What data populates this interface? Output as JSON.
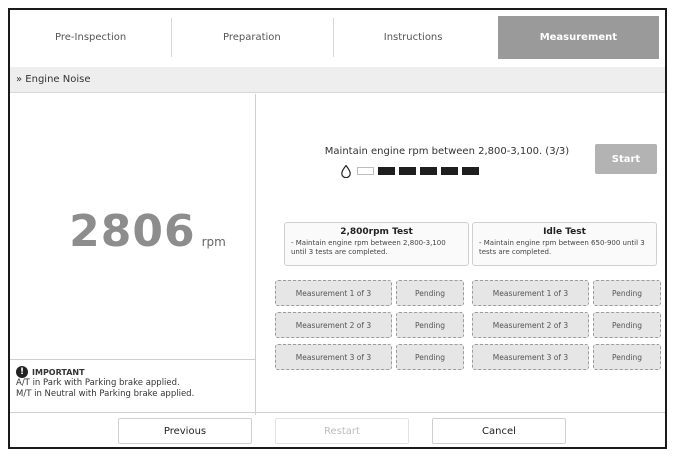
{
  "tabs": [
    {
      "label": "Pre-Inspection",
      "active": false
    },
    {
      "label": "Preparation",
      "active": false
    },
    {
      "label": "Instructions",
      "active": false
    },
    {
      "label": "Measurement",
      "active": true
    }
  ],
  "section": {
    "title": "» Engine Noise"
  },
  "rpm": {
    "value": "2806",
    "unit": "rpm"
  },
  "notice": {
    "heading": "IMPORTANT",
    "line1": "A/T in Park with Parking brake applied.",
    "line2": "M/T in Neutral with Parking brake applied."
  },
  "instruction": "Maintain engine rpm between 2,800-3,100. (3/3)",
  "progress": {
    "total": 6,
    "filled": 5
  },
  "start_button": "Start",
  "tests": [
    {
      "title": "2,800rpm Test",
      "desc": "- Maintain engine rpm between 2,800-3,100 until 3 tests are completed.",
      "rows": [
        {
          "measure": "Measurement 1 of 3",
          "status": "Pending"
        },
        {
          "measure": "Measurement 2 of 3",
          "status": "Pending"
        },
        {
          "measure": "Measurement 3 of 3",
          "status": "Pending"
        }
      ]
    },
    {
      "title": "Idle Test",
      "desc": "- Maintain engine rpm between 650-900 until 3 tests are completed.",
      "rows": [
        {
          "measure": "Measurement 1 of 3",
          "status": "Pending"
        },
        {
          "measure": "Measurement 2 of 3",
          "status": "Pending"
        },
        {
          "measure": "Measurement 3 of 3",
          "status": "Pending"
        }
      ]
    }
  ],
  "footer": {
    "previous": "Previous",
    "restart": "Restart",
    "cancel": "Cancel"
  },
  "icons": {
    "info": "info-icon",
    "drop": "drop-icon"
  },
  "colors": {
    "active_tab": "#9a9a9a",
    "filled_segment": "#1e1e1e",
    "start_button": "#b3b3b3"
  }
}
